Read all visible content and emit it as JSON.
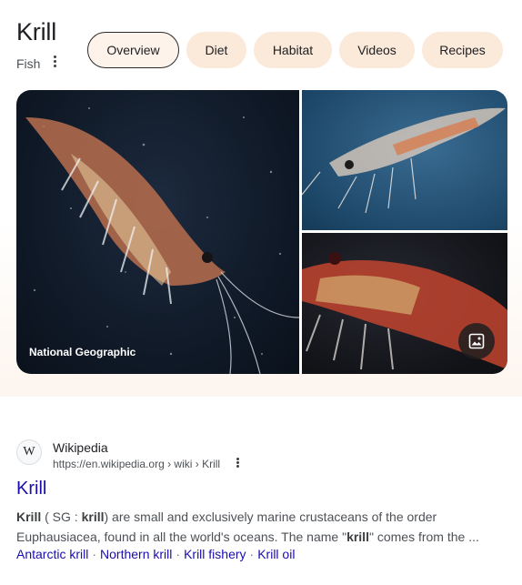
{
  "entity": {
    "title": "Krill",
    "subtitle": "Fish"
  },
  "tabs": [
    {
      "label": "Overview",
      "active": true
    },
    {
      "label": "Diet",
      "active": false
    },
    {
      "label": "Habitat",
      "active": false
    },
    {
      "label": "Videos",
      "active": false
    },
    {
      "label": "Recipes",
      "active": false
    }
  ],
  "gallery": {
    "credit": "National Geographic",
    "images_icon": "image-icon"
  },
  "result": {
    "favicon_letter": "W",
    "site_name": "Wikipedia",
    "url": "https://en.wikipedia.org › wiki › Krill",
    "title": "Krill",
    "snippet_parts": {
      "p1": "Krill",
      "p2": " ( SG : ",
      "p3": "krill",
      "p4": ") are small and exclusively marine crustaceans of the order Euphausiacea, found in all the world's oceans. The name \"",
      "p5": "krill",
      "p6": "\" comes from the ..."
    },
    "sitelinks": [
      "Antarctic krill",
      "Northern krill",
      "Krill fishery",
      "Krill oil"
    ]
  },
  "colors": {
    "link": "#1a0dab",
    "tab_bg": "#fbe9da",
    "panel_tint": "#fdf5ef"
  }
}
